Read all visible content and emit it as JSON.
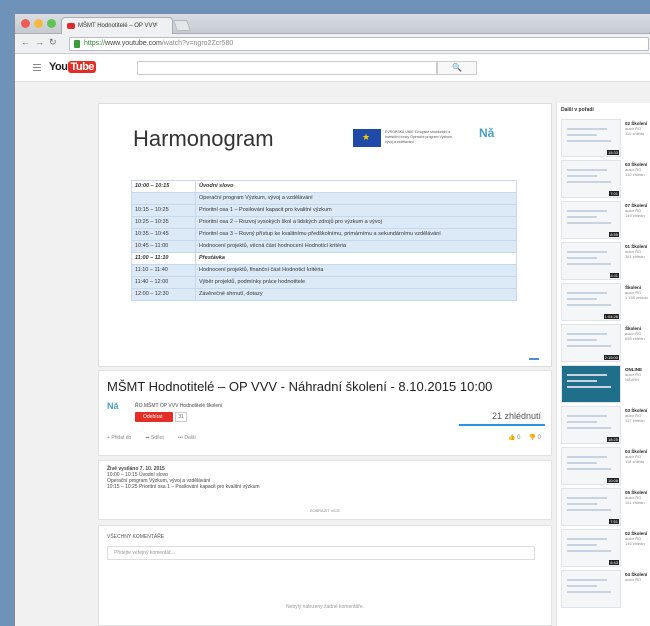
{
  "browser": {
    "tab_title": "MŠMT Hodnotitelé – OP VVV",
    "tab_close": "×",
    "url_https": "https://",
    "url_host": "www.youtube.com",
    "url_path": "/watch?v=ngro2Zcr580"
  },
  "youtube": {
    "logo_you": "You",
    "logo_tube": "Tube",
    "search_icon": "🔍"
  },
  "slide": {
    "title": "Harmonogram",
    "eu_text": "EVROPSKÁ UNIE Evropské strukturální a investiční fondy Operační program Výzkum, vývoj a vzdělávání",
    "logo": "Nǎ",
    "rows": [
      {
        "time": "10:00 – 10:15",
        "item": "Úvodní slovo",
        "style": "bold"
      },
      {
        "time": "",
        "item": "Operační program Výzkum, vývoj a vzdělávání",
        "style": "hl"
      },
      {
        "time": "10:15 – 10:25",
        "item": "Prioritní osa 1 – Posilování kapacit pro kvalitní výzkum",
        "style": "hl"
      },
      {
        "time": "10:25 – 10:35",
        "item": "Prioritní osa 2 – Rozvoj vysokých škol a lidských zdrojů pro výzkum a vývoj",
        "style": "hl"
      },
      {
        "time": "10:35 – 10:45",
        "item": "Prioritní osa 3 – Rovný přístup ke kvalitnímu předškolnímu, primárnímu a sekundárnímu vzdělávání",
        "style": "hl"
      },
      {
        "time": "10:45 – 11:00",
        "item": "Hodnocení projektů, věcná část hodnocení Hodnoticí kritéria",
        "style": "hl"
      },
      {
        "time": "11:00 – 11:10",
        "item": "Přestávka",
        "style": "bold"
      },
      {
        "time": "11:10 – 11:40",
        "item": "Hodnocení projektů, finanční část Hodnoticí kritéria",
        "style": "hl"
      },
      {
        "time": "11:40 – 12:00",
        "item": "Výběr projektů, podmínky práce hodnotitele",
        "style": "hl"
      },
      {
        "time": "12:00 – 12:30",
        "item": "Závěrečné shrnutí, dotazy",
        "style": "hl"
      }
    ]
  },
  "video": {
    "title": "MŠMT Hodnotitelé – OP VVV - Náhradní školení - 8.10.2015 10:00",
    "channel_logo": "Nǎ",
    "channel_name": "ŘO MŠMT OP VVV Hodnotitelé školení",
    "subscribe_label": "Odebírat",
    "subscriber_count": "31",
    "views": "21 zhlédnutí",
    "actions": [
      "Přidat do",
      "Sdílet",
      "Další"
    ],
    "likes": "0",
    "dislikes": "0"
  },
  "description": {
    "lines": [
      "Živě vysíláno 7. 10. 2015",
      "10:00 – 10:15 Úvodní slovo",
      "Operační program Výzkum, vývoj a vzdělávání",
      "10:15 – 10:25 Prioritní osa 1 – Posilování kapacit pro kvalitní výzkum"
    ],
    "more_label": "ZOBRAZIT VÍCE"
  },
  "comments": {
    "header": "VŠECHNY KOMENTÁŘE",
    "placeholder": "Přidejte veřejný komentář...",
    "empty": "Nebyly nalezeny žádné komentáře."
  },
  "sidebar": {
    "title": "Další v pořadí",
    "items": [
      {
        "title": "02 Školení",
        "meta1": "autor ŘO",
        "meta2": "110 zhlédn",
        "duration": "15:33"
      },
      {
        "title": "03 Školení",
        "meta1": "autor ŘO",
        "meta2": "132 zhlédn",
        "duration": "7:01"
      },
      {
        "title": "07 Školení",
        "meta1": "autor ŘO",
        "meta2": "149 zhlédn",
        "duration": "8:55"
      },
      {
        "title": "01 Školení",
        "meta1": "autor ŘO",
        "meta2": "381 zhlédn",
        "duration": "4:11"
      },
      {
        "title": "Školení",
        "meta1": "autor ŘO",
        "meta2": "1 155 zhlédn",
        "duration": "1:04:28"
      },
      {
        "title": "Školení",
        "meta1": "autor ŘO",
        "meta2": "655 zhlédn",
        "duration": "2:15:00"
      },
      {
        "title": "ONLINE",
        "meta1": "autor ŘO",
        "meta2": "NÁVRH",
        "duration": ""
      },
      {
        "title": "03 Školení",
        "meta1": "autor ŘO",
        "meta2": "127 zhlédn",
        "duration": "18:25"
      },
      {
        "title": "04 Školení",
        "meta1": "autor ŘO",
        "meta2": "118 zhlédn",
        "duration": "10:08"
      },
      {
        "title": "05 Školení",
        "meta1": "autor ŘO",
        "meta2": "141 zhlédn",
        "duration": "7:51"
      },
      {
        "title": "02 Školení",
        "meta1": "autor ŘO",
        "meta2": "146 zhlédn",
        "duration": "5:43"
      },
      {
        "title": "04 Školení",
        "meta1": "autor ŘO",
        "meta2": "",
        "duration": ""
      }
    ]
  },
  "colors": {
    "brand_red": "#e52d27",
    "accent_blue": "#2793e6"
  }
}
